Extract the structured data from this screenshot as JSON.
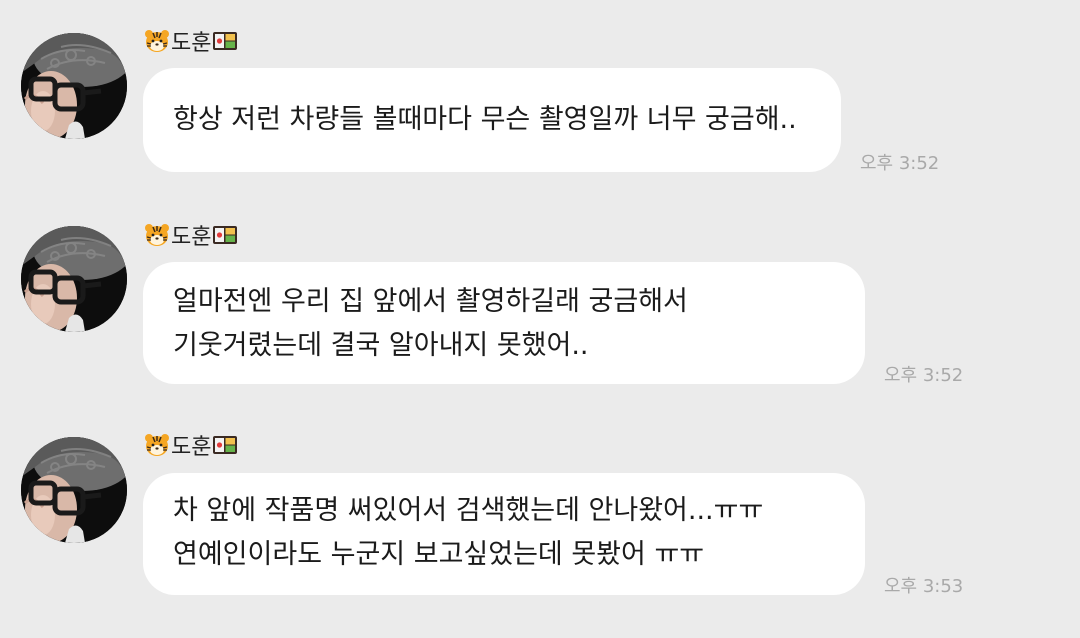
{
  "chat": {
    "messages": [
      {
        "sender": "도훈",
        "sender_prefix_icon": "tiger-face-icon",
        "sender_suffix_icon": "bento-box-icon",
        "lines": [
          "항상 저런 차량들 볼때마다 무슨 촬영일까 너무 궁금해.."
        ],
        "time": "오후 3:52"
      },
      {
        "sender": "도훈",
        "sender_prefix_icon": "tiger-face-icon",
        "sender_suffix_icon": "bento-box-icon",
        "lines": [
          "얼마전엔 우리 집 앞에서 촬영하길래 궁금해서",
          "기웃거렸는데 결국 알아내지 못했어.."
        ],
        "time": "오후 3:52"
      },
      {
        "sender": "도훈",
        "sender_prefix_icon": "tiger-face-icon",
        "sender_suffix_icon": "bento-box-icon",
        "lines": [
          "차 앞에 작품명 써있어서 검색했는데 안나왔어...ㅠㅠ",
          "연예인이라도 누군지 보고싶었는데 못봤어 ㅠㅠ"
        ],
        "time": "오후 3:53"
      }
    ]
  },
  "colors": {
    "background": "#ebebeb",
    "bubble": "#ffffff",
    "text": "#1b1b1b",
    "time": "#a9a9a9"
  }
}
